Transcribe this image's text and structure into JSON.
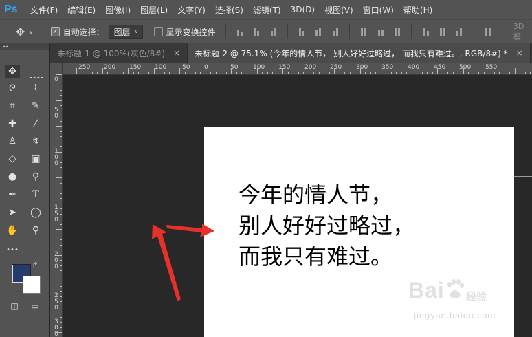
{
  "app": {
    "logo": "Ps",
    "menu": [
      "文件(F)",
      "编辑(E)",
      "图像(I)",
      "图层(L)",
      "文字(Y)",
      "选择(S)",
      "滤镜(T)",
      "3D(D)",
      "视图(V)",
      "窗口(W)",
      "帮助(H)"
    ]
  },
  "options": {
    "auto_select_label": "自动选择：",
    "auto_select_checked": true,
    "auto_select_target": "图层",
    "show_transform_label": "显示变换控件",
    "show_transform_checked": false,
    "mode_3d_label": "3D 模"
  },
  "toolbar": {
    "collapse_glyph": "◂◂",
    "tools": [
      {
        "name": "move-tool-icon",
        "glyph": "✥",
        "active": true
      },
      {
        "name": "marquee-tool-icon",
        "glyph": "⬚",
        "active": false
      },
      {
        "name": "lasso-tool-icon",
        "glyph": "ᘓ",
        "active": false
      },
      {
        "name": "quick-select-tool-icon",
        "glyph": "⌇",
        "active": false
      },
      {
        "name": "crop-tool-icon",
        "glyph": "⌗",
        "active": false
      },
      {
        "name": "eyedropper-tool-icon",
        "glyph": "✎",
        "active": false
      },
      {
        "name": "healing-brush-tool-icon",
        "glyph": "✚",
        "active": false
      },
      {
        "name": "brush-tool-icon",
        "glyph": "⁄",
        "active": false
      },
      {
        "name": "stamp-tool-icon",
        "glyph": "♙",
        "active": false
      },
      {
        "name": "history-brush-tool-icon",
        "glyph": "↯",
        "active": false
      },
      {
        "name": "eraser-tool-icon",
        "glyph": "◇",
        "active": false
      },
      {
        "name": "gradient-tool-icon",
        "glyph": "▣",
        "active": false
      },
      {
        "name": "blur-tool-icon",
        "glyph": "●",
        "active": false
      },
      {
        "name": "dodge-tool-icon",
        "glyph": "⚲",
        "active": false
      },
      {
        "name": "pen-tool-icon",
        "glyph": "✒",
        "active": false
      },
      {
        "name": "type-tool-icon",
        "glyph": "T",
        "active": false
      },
      {
        "name": "path-select-tool-icon",
        "glyph": "➤",
        "active": false
      },
      {
        "name": "ellipse-tool-icon",
        "glyph": "◯",
        "active": false
      },
      {
        "name": "hand-tool-icon",
        "glyph": "✋",
        "active": false
      },
      {
        "name": "zoom-tool-icon",
        "glyph": "⚲",
        "active": false
      },
      {
        "name": "more-tools-icon",
        "glyph": "•••",
        "active": false
      },
      {
        "name": "swap-colors-icon",
        "glyph": "↱",
        "active": false
      },
      {
        "name": "quick-mask-icon",
        "glyph": "◫",
        "active": false
      },
      {
        "name": "screen-mode-icon",
        "glyph": "▭",
        "active": false
      }
    ],
    "foreground_color": "#263a6e",
    "background_color": "#ffffff"
  },
  "tabs": [
    {
      "label": "未标题-1 @ 100%(灰色/8#)",
      "active": false
    },
    {
      "label": "未标题-2 @ 75.1% (今年的情人节，  别人好好过略过，  而我只有难过。, RGB/8#) *",
      "active": true
    }
  ],
  "rulers": {
    "top_labels": [
      "250",
      "200",
      "150",
      "100",
      "50",
      "0",
      "50",
      "100",
      "150",
      "200",
      "250",
      "300",
      "350",
      "400",
      "450",
      "500",
      "550"
    ],
    "left_labels": [
      "0",
      "5\n0",
      "1\n0\n0",
      "1\n5\n0",
      "2\n0\n0",
      "2\n5\n0",
      "3\n0\n0"
    ]
  },
  "document": {
    "text": "今年的情人节，\n别人好好过略过，\n而我只有难过。"
  },
  "watermark": {
    "main": "Bai  ",
    "cn": "经验",
    "sub": "jingyan.baidu.com"
  },
  "colors": {
    "annotation_arrow": "#e8302a"
  }
}
